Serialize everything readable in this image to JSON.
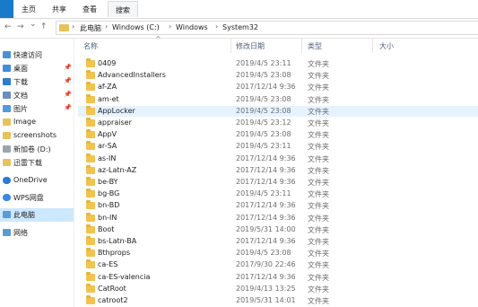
{
  "ribbon": {
    "tabs": [
      "主页",
      "共享",
      "查看"
    ],
    "active_tab": "搜索",
    "file_tab_color": "#1979ca"
  },
  "nav": {
    "back": "←",
    "forward": "→",
    "up_caret": "⌄",
    "up": "↑"
  },
  "address": {
    "crumbs": [
      "此电脑",
      "Windows (C:)",
      "Windows",
      "System32"
    ],
    "separator": "›"
  },
  "sidebar": {
    "items": [
      {
        "label": "快速访问",
        "icon": "star-icon",
        "color": "#4a90d9",
        "pinned": false
      },
      {
        "label": "桌面",
        "icon": "desktop-icon",
        "color": "#3f8ddb",
        "pinned": true
      },
      {
        "label": "下载",
        "icon": "download-icon",
        "color": "#2f7bd1",
        "pinned": true
      },
      {
        "label": "文档",
        "icon": "document-icon",
        "color": "#6c8ebf",
        "pinned": true
      },
      {
        "label": "图片",
        "icon": "pictures-icon",
        "color": "#4f9bd9",
        "pinned": true
      },
      {
        "label": "Image",
        "icon": "folder-icon",
        "color": "#e8c35b",
        "pinned": false
      },
      {
        "label": "screenshots",
        "icon": "folder-icon",
        "color": "#e8c35b",
        "pinned": false
      },
      {
        "label": "新加卷 (D:)",
        "icon": "drive-icon",
        "color": "#9aa5b1",
        "pinned": false
      },
      {
        "label": "迅雷下载",
        "icon": "folder-icon",
        "color": "#e8c35b",
        "pinned": false
      },
      {
        "label": "OneDrive",
        "icon": "cloud-icon",
        "color": "#2b7cd3",
        "pinned": false
      },
      {
        "label": "WPS网盘",
        "icon": "cloud-icon",
        "color": "#3a86e8",
        "pinned": false
      },
      {
        "label": "此电脑",
        "icon": "computer-icon",
        "color": "#5a9bd6",
        "pinned": false
      },
      {
        "label": "网络",
        "icon": "network-icon",
        "color": "#5a9bd6",
        "pinned": false
      }
    ],
    "selected_index": 11,
    "pin_glyph": "📌"
  },
  "columns": {
    "name": "名称",
    "modified": "修改日期",
    "type": "类型",
    "size": "大小",
    "sort_glyph": "^"
  },
  "files": [
    {
      "name": "0409",
      "date": "2019/4/5 23:11",
      "type": "文件夹"
    },
    {
      "name": "AdvancedInstallers",
      "date": "2019/4/5 23:08",
      "type": "文件夹"
    },
    {
      "name": "af-ZA",
      "date": "2017/12/14 9:36",
      "type": "文件夹"
    },
    {
      "name": "am-et",
      "date": "2019/4/5 23:08",
      "type": "文件夹"
    },
    {
      "name": "AppLocker",
      "date": "2019/4/5 23:08",
      "type": "文件夹"
    },
    {
      "name": "appraiser",
      "date": "2019/4/5 23:12",
      "type": "文件夹"
    },
    {
      "name": "AppV",
      "date": "2019/4/5 23:08",
      "type": "文件夹"
    },
    {
      "name": "ar-SA",
      "date": "2019/4/5 23:11",
      "type": "文件夹"
    },
    {
      "name": "as-IN",
      "date": "2017/12/14 9:36",
      "type": "文件夹"
    },
    {
      "name": "az-Latn-AZ",
      "date": "2017/12/14 9:36",
      "type": "文件夹"
    },
    {
      "name": "be-BY",
      "date": "2017/12/14 9:36",
      "type": "文件夹"
    },
    {
      "name": "bg-BG",
      "date": "2019/4/5 23:11",
      "type": "文件夹"
    },
    {
      "name": "bn-BD",
      "date": "2017/12/14 9:36",
      "type": "文件夹"
    },
    {
      "name": "bn-IN",
      "date": "2017/12/14 9:36",
      "type": "文件夹"
    },
    {
      "name": "Boot",
      "date": "2019/5/31 14:00",
      "type": "文件夹"
    },
    {
      "name": "bs-Latn-BA",
      "date": "2017/12/14 9:36",
      "type": "文件夹"
    },
    {
      "name": "Bthprops",
      "date": "2019/4/5 23:08",
      "type": "文件夹"
    },
    {
      "name": "ca-ES",
      "date": "2017/9/30 22:46",
      "type": "文件夹"
    },
    {
      "name": "ca-ES-valencia",
      "date": "2017/12/14 9:36",
      "type": "文件夹"
    },
    {
      "name": "CatRoot",
      "date": "2019/4/13 13:25",
      "type": "文件夹"
    },
    {
      "name": "catroot2",
      "date": "2019/5/31 14:01",
      "type": "文件夹"
    }
  ],
  "selected_file_index": 4,
  "colors": {
    "selection": "#cce8ff",
    "row_selection": "#e5f3ff",
    "folder": "#f1c34f",
    "header_text": "#4c607a"
  }
}
